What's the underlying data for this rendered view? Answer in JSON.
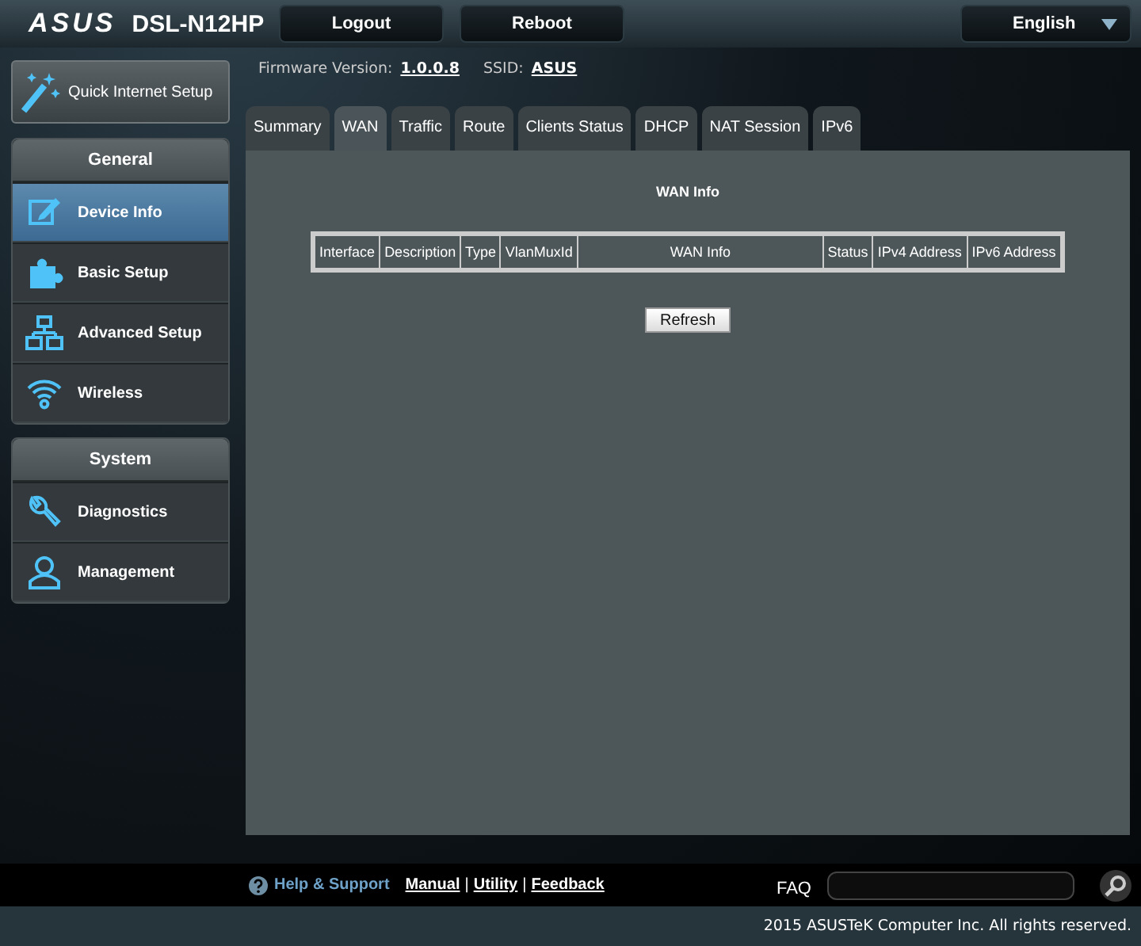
{
  "header": {
    "logo": "ASUS",
    "model": "DSL-N12HP",
    "buttons": [
      "Logout",
      "Reboot"
    ],
    "language": "English"
  },
  "info": {
    "firmware_label": "Firmware Version:",
    "firmware": "1.0.0.8",
    "ssid_label": "SSID:",
    "ssid": "ASUS"
  },
  "quick_setup": "Quick Internet Setup",
  "sidebar": [
    {
      "title": "General",
      "items": [
        {
          "label": "Device Info",
          "kind": "edit",
          "selected": true
        },
        {
          "label": "Basic Setup",
          "kind": "puzzle",
          "selected": false
        },
        {
          "label": "Advanced Setup",
          "kind": "network",
          "selected": false
        },
        {
          "label": "Wireless",
          "kind": "wifi",
          "selected": false
        }
      ]
    },
    {
      "title": "System",
      "items": [
        {
          "label": "Diagnostics",
          "kind": "wrench",
          "selected": false
        },
        {
          "label": "Management",
          "kind": "user",
          "selected": false
        }
      ]
    }
  ],
  "tabs": [
    {
      "label": "Summary",
      "selected": false
    },
    {
      "label": "WAN",
      "selected": true
    },
    {
      "label": "Traffic",
      "selected": false
    },
    {
      "label": "Route",
      "selected": false
    },
    {
      "label": "Clients Status",
      "selected": false
    },
    {
      "label": "DHCP",
      "selected": false
    },
    {
      "label": "NAT Session",
      "selected": false
    },
    {
      "label": "IPv6",
      "selected": false
    }
  ],
  "panel": {
    "title": "WAN Info",
    "table": {
      "columns": [
        "Interface",
        "Description",
        "Type",
        "VlanMuxId",
        "WAN Info",
        "Status",
        "IPv4 Address",
        "IPv6 Address"
      ]
    },
    "button": "Refresh"
  },
  "footer": {
    "help": "Help & Support",
    "links": [
      {
        "kind": "link",
        "label": "Manual"
      },
      {
        "kind": "separator",
        "label": "|"
      },
      {
        "kind": "link",
        "label": "Utility"
      },
      {
        "kind": "separator",
        "label": "|"
      },
      {
        "kind": "link",
        "label": "Feedback"
      }
    ],
    "faq_label": "FAQ",
    "copyright": "2015 ASUSTeK Computer Inc. All rights reserved."
  }
}
